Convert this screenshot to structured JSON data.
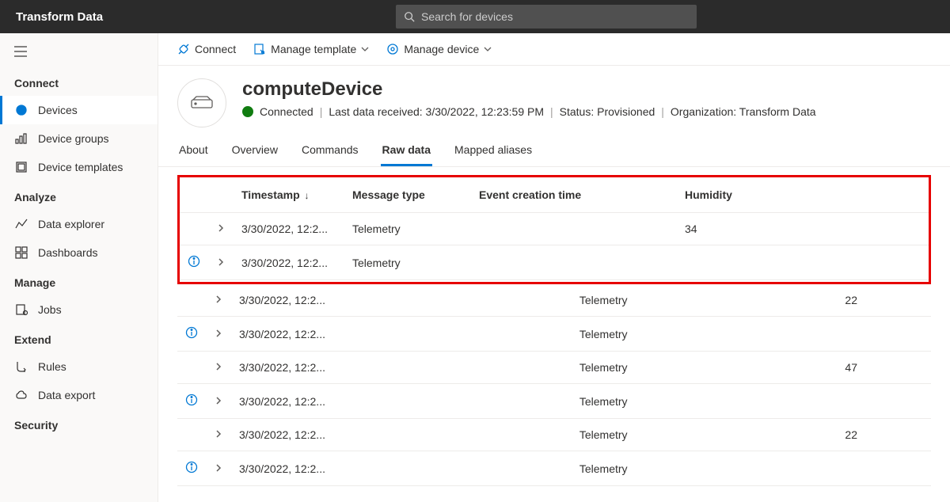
{
  "header": {
    "title": "Transform Data",
    "search_placeholder": "Search for devices"
  },
  "sidebar": {
    "sections": [
      {
        "title": "Connect",
        "items": [
          {
            "icon": "devices",
            "label": "Devices",
            "active": true
          },
          {
            "icon": "device-groups",
            "label": "Device groups"
          },
          {
            "icon": "device-templates",
            "label": "Device templates"
          }
        ]
      },
      {
        "title": "Analyze",
        "items": [
          {
            "icon": "data-explorer",
            "label": "Data explorer"
          },
          {
            "icon": "dashboards",
            "label": "Dashboards"
          }
        ]
      },
      {
        "title": "Manage",
        "items": [
          {
            "icon": "jobs",
            "label": "Jobs"
          }
        ]
      },
      {
        "title": "Extend",
        "items": [
          {
            "icon": "rules",
            "label": "Rules"
          },
          {
            "icon": "data-export",
            "label": "Data export"
          }
        ]
      },
      {
        "title": "Security",
        "items": []
      }
    ]
  },
  "actionbar": {
    "connect": "Connect",
    "manage_template": "Manage template",
    "manage_device": "Manage device"
  },
  "device": {
    "name": "computeDevice",
    "status_label": "Connected",
    "last_data_label": "Last data received: 3/30/2022, 12:23:59 PM",
    "status_field": "Status: Provisioned",
    "org_field": "Organization: Transform Data"
  },
  "tabs": [
    "About",
    "Overview",
    "Commands",
    "Raw data",
    "Mapped aliases"
  ],
  "active_tab": "Raw data",
  "table": {
    "headers": {
      "timestamp": "Timestamp",
      "message_type": "Message type",
      "event_creation": "Event creation time",
      "humidity": "Humidity"
    },
    "rows": [
      {
        "info": false,
        "timestamp": "3/30/2022, 12:2...",
        "message_type": "Telemetry",
        "event_creation": "",
        "humidity": "34",
        "highlighted": true
      },
      {
        "info": true,
        "timestamp": "3/30/2022, 12:2...",
        "message_type": "Telemetry",
        "event_creation": "",
        "humidity": "",
        "highlighted": true
      },
      {
        "info": false,
        "timestamp": "3/30/2022, 12:2...",
        "message_type": "Telemetry",
        "event_creation": "",
        "humidity": "22"
      },
      {
        "info": true,
        "timestamp": "3/30/2022, 12:2...",
        "message_type": "Telemetry",
        "event_creation": "",
        "humidity": ""
      },
      {
        "info": false,
        "timestamp": "3/30/2022, 12:2...",
        "message_type": "Telemetry",
        "event_creation": "",
        "humidity": "47"
      },
      {
        "info": true,
        "timestamp": "3/30/2022, 12:2...",
        "message_type": "Telemetry",
        "event_creation": "",
        "humidity": ""
      },
      {
        "info": false,
        "timestamp": "3/30/2022, 12:2...",
        "message_type": "Telemetry",
        "event_creation": "",
        "humidity": "22"
      },
      {
        "info": true,
        "timestamp": "3/30/2022, 12:2...",
        "message_type": "Telemetry",
        "event_creation": "",
        "humidity": ""
      }
    ]
  }
}
